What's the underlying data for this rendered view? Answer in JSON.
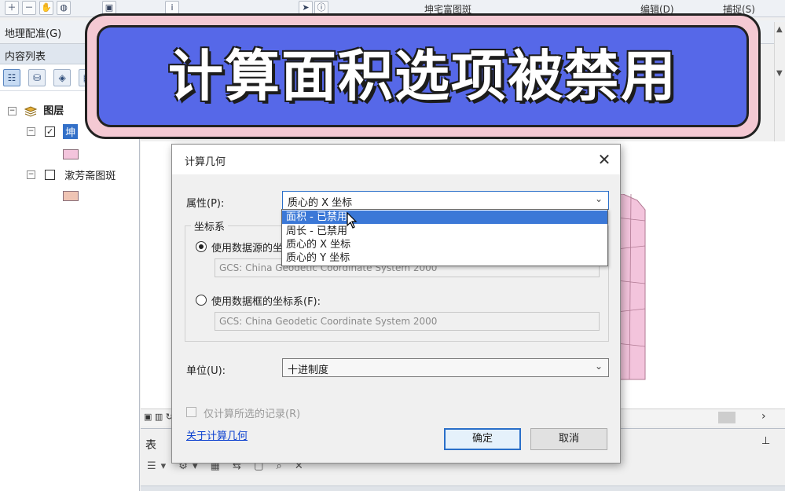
{
  "top_toolbar": {
    "layer_dropdown": "坤宅富图斑",
    "editor_menu": "编辑(D)",
    "snapping_menu": "捕捉(S)"
  },
  "georef_toolbar": {
    "label": "地理配准(G)"
  },
  "toc": {
    "title": "内容列表",
    "root_label": "图层",
    "layers": [
      {
        "label": "坤",
        "checked": true,
        "swatch_color": "#f3c4dc"
      },
      {
        "label": "漱芳斋图斑",
        "checked": false,
        "swatch_color": "#efc4b4"
      }
    ]
  },
  "banner": {
    "text": "计算面积选项被禁用"
  },
  "dialog": {
    "title": "计算几何",
    "property_label": "属性(P):",
    "property_value": "质心的 X 坐标",
    "property_options": [
      "面积 - 已禁用",
      "周长 - 已禁用",
      "质心的 X 坐标",
      "质心的 Y 坐标"
    ],
    "coord_group_label": "坐标系",
    "option_source_label": "使用数据源的坐标系(D):",
    "option_source_value": "GCS: China Geodetic Coordinate System 2000",
    "option_frame_label": "使用数据框的坐标系(F):",
    "option_frame_value": "GCS: China Geodetic Coordinate System 2000",
    "units_label": "单位(U):",
    "units_value": "十进制度",
    "selected_only_label": "仅计算所选的记录(R)",
    "help_link": "关于计算几何",
    "ok_label": "确定",
    "cancel_label": "取消"
  },
  "table_panel": {
    "title": "表",
    "pin": "ϕ"
  }
}
